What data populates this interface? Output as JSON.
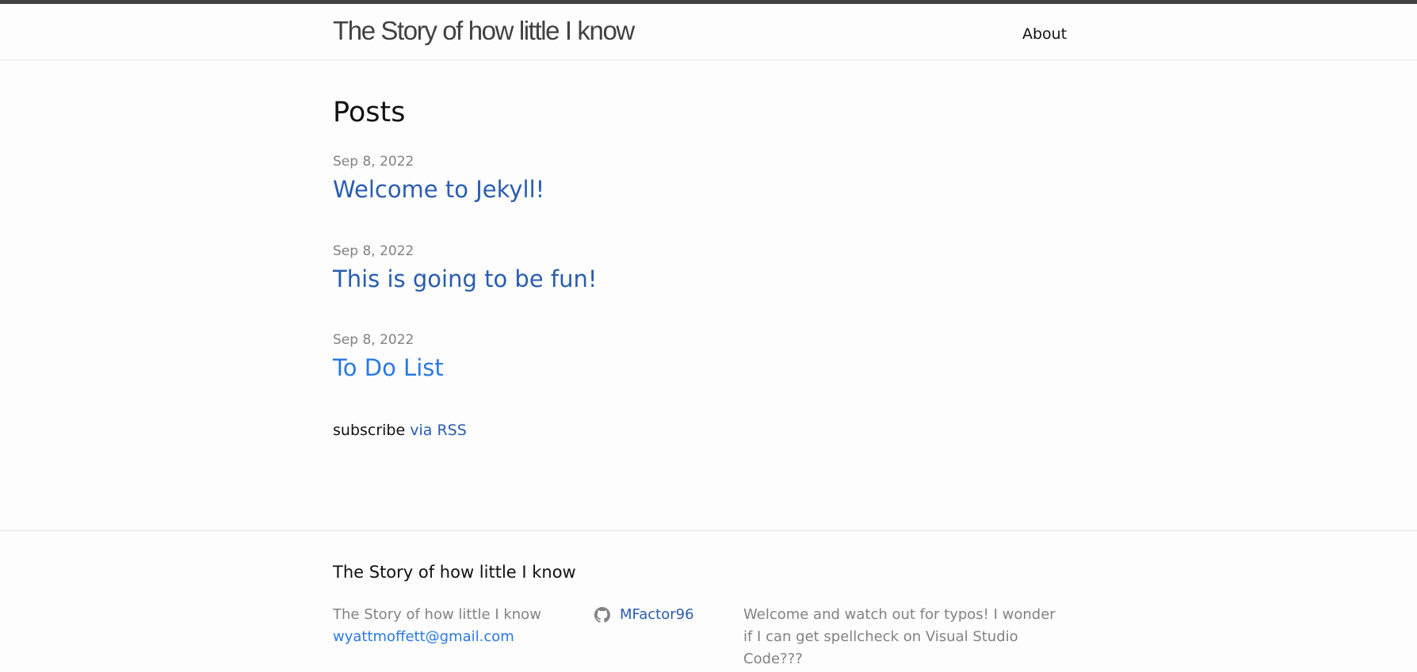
{
  "header": {
    "site_title": "The Story of how little I know",
    "nav": [
      {
        "label": "About"
      }
    ]
  },
  "main": {
    "heading": "Posts",
    "posts": [
      {
        "date": "Sep 8, 2022",
        "title": "Welcome to Jekyll!"
      },
      {
        "date": "Sep 8, 2022",
        "title": "This is going to be fun!"
      },
      {
        "date": "Sep 8, 2022",
        "title": "To Do List"
      }
    ],
    "subscribe_text": "subscribe",
    "rss_link": "via RSS"
  },
  "footer": {
    "heading": "The Story of how little I know",
    "site_name": "The Story of how little I know",
    "email": "wyattmoffett@gmail.com",
    "github_user": "MFactor96",
    "description": "Welcome and watch out for typos! I wonder if I can get spellcheck on Visual Studio Code???"
  },
  "colors": {
    "link": "#2a5db0",
    "link_hover": "#2a7ae2",
    "meta_grey": "#828282",
    "top_bar": "#424242"
  },
  "icons": [
    "github-icon"
  ]
}
